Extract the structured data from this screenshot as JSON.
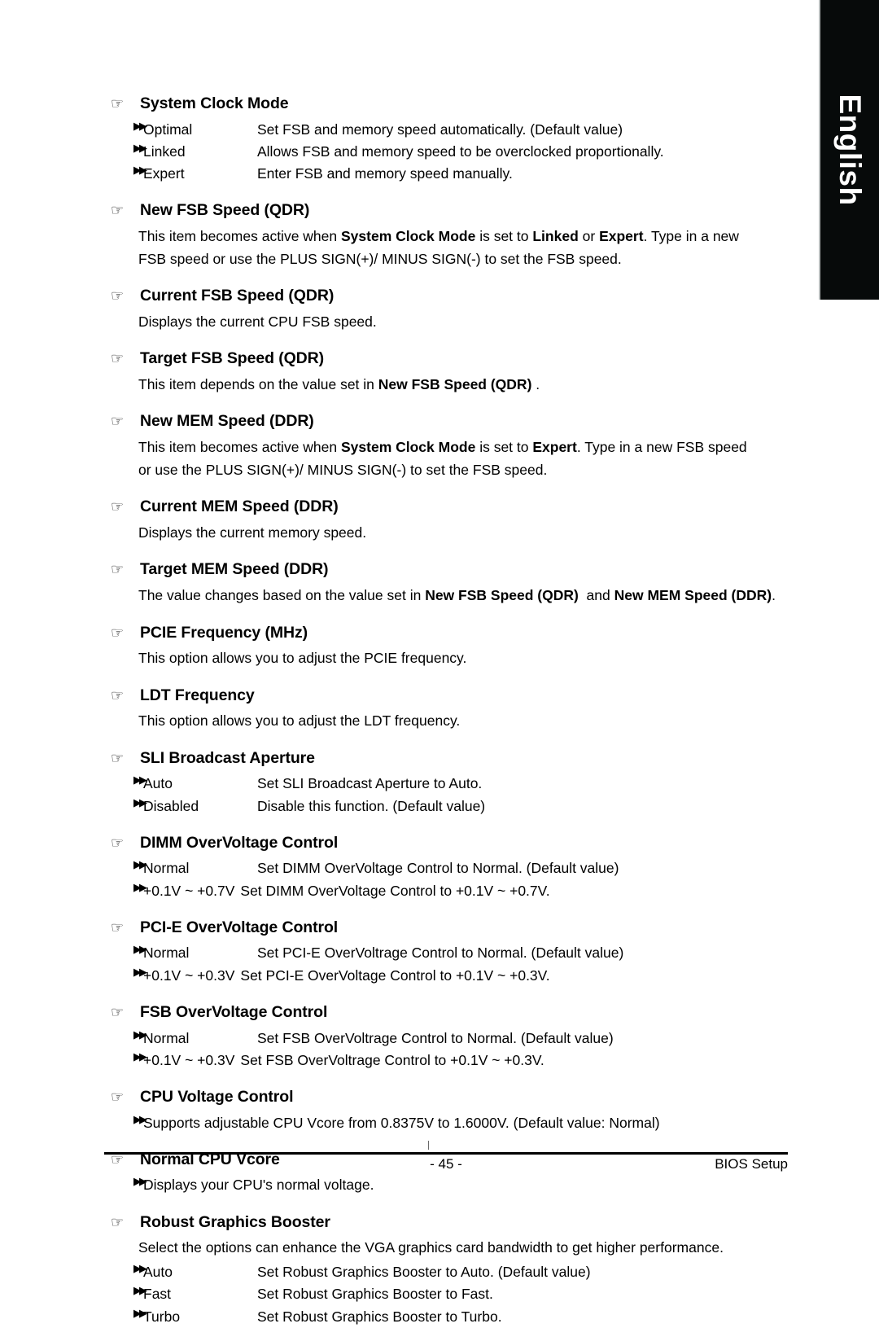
{
  "language_tab": {
    "label": "English"
  },
  "icons": {
    "hand": "☞",
    "arrow": "▶▶"
  },
  "sections": [
    {
      "heading": "System Clock Mode",
      "options": [
        {
          "term": "Optimal",
          "desc": "Set FSB and memory speed automatically. (Default value)"
        },
        {
          "term": "Linked",
          "desc": "Allows FSB and memory speed to be overclocked proportionally."
        },
        {
          "term": "Expert",
          "desc": "Enter FSB and memory speed manually."
        }
      ]
    },
    {
      "heading": "New FSB Speed (QDR)",
      "paragraph_line1_a": "This item becomes active when ",
      "paragraph_line1_b": "System Clock Mode",
      "paragraph_line1_c": " is set to ",
      "paragraph_line1_d": "Linked",
      "paragraph_line1_e": " or ",
      "paragraph_line1_f": "Expert",
      "paragraph_line1_g": ". Type in a new",
      "paragraph_line2": "FSB speed or use the PLUS SIGN(+)/ MINUS SIGN(-) to set the FSB speed."
    },
    {
      "heading": "Current FSB Speed (QDR)",
      "paragraph": "Displays the current CPU FSB speed."
    },
    {
      "heading": "Target FSB Speed (QDR)",
      "paragraph_a": "This item depends on the value set in ",
      "paragraph_b": "New FSB Speed (QDR)",
      "paragraph_c": " ."
    },
    {
      "heading": "New MEM Speed (DDR)",
      "paragraph_line1_a": "This item becomes active when ",
      "paragraph_line1_b": "System Clock Mode",
      "paragraph_line1_c": " is set to ",
      "paragraph_line1_d": "Expert",
      "paragraph_line1_e": ". Type in a new FSB speed",
      "paragraph_line2": "or use the PLUS SIGN(+)/ MINUS SIGN(-) to set the FSB speed."
    },
    {
      "heading": "Current MEM Speed (DDR)",
      "paragraph": "Displays the current memory speed."
    },
    {
      "heading": "Target MEM Speed (DDR)",
      "paragraph_a": "The value changes based on the value set in ",
      "paragraph_b": "New FSB Speed (QDR)",
      "paragraph_c": "  and ",
      "paragraph_d": "New MEM Speed (DDR)",
      "paragraph_e": "."
    },
    {
      "heading": "PCIE Frequency (MHz)",
      "paragraph": "This option allows you to adjust the PCIE frequency."
    },
    {
      "heading": "LDT Frequency",
      "paragraph": "This option allows you to adjust the LDT frequency."
    },
    {
      "heading": "SLI Broadcast Aperture",
      "options": [
        {
          "term": "Auto",
          "desc": "Set SLI Broadcast Aperture to Auto."
        },
        {
          "term": "Disabled",
          "desc": "Disable this function. (Default value)"
        }
      ]
    },
    {
      "heading": "DIMM OverVoltage Control",
      "options": [
        {
          "term": "Normal",
          "desc": "Set DIMM OverVoltage Control to Normal. (Default value)"
        },
        {
          "term": "+0.1V ~ +0.7V",
          "desc": "Set DIMM OverVoltage Control to +0.1V ~ +0.7V."
        }
      ]
    },
    {
      "heading": "PCI-E OverVoltage Control",
      "options": [
        {
          "term": "Normal",
          "desc": "Set PCI-E OverVoltrage Control to Normal. (Default value)"
        },
        {
          "term": "+0.1V ~ +0.3V",
          "desc": "Set PCI-E OverVoltage Control to +0.1V ~ +0.3V."
        }
      ]
    },
    {
      "heading": "FSB OverVoltage Control",
      "options": [
        {
          "term": "Normal",
          "desc": "Set FSB OverVoltrage Control to Normal. (Default value)"
        },
        {
          "term": "+0.1V ~ +0.3V",
          "desc": "Set FSB OverVoltrage Control to +0.1V ~ +0.3V."
        }
      ]
    },
    {
      "heading": "CPU Voltage Control",
      "options": [
        {
          "term": "Supports adjustable CPU Vcore from 0.8375V to 1.6000V. (Default value: Normal)",
          "desc": ""
        }
      ]
    },
    {
      "heading": "Normal CPU Vcore",
      "options": [
        {
          "term": "Displays your CPU's normal voltage.",
          "desc": ""
        }
      ]
    },
    {
      "heading": "Robust Graphics Booster",
      "paragraph": "Select the options can enhance the VGA graphics card bandwidth to get higher performance.",
      "options": [
        {
          "term": "Auto",
          "desc": "Set Robust Graphics Booster to Auto. (Default value)"
        },
        {
          "term": "Fast",
          "desc": "Set Robust Graphics Booster to Fast."
        },
        {
          "term": "Turbo",
          "desc": "Set Robust Graphics Booster to Turbo."
        }
      ]
    }
  ],
  "footer": {
    "page_number": "- 45 -",
    "doc_label": "BIOS Setup"
  }
}
